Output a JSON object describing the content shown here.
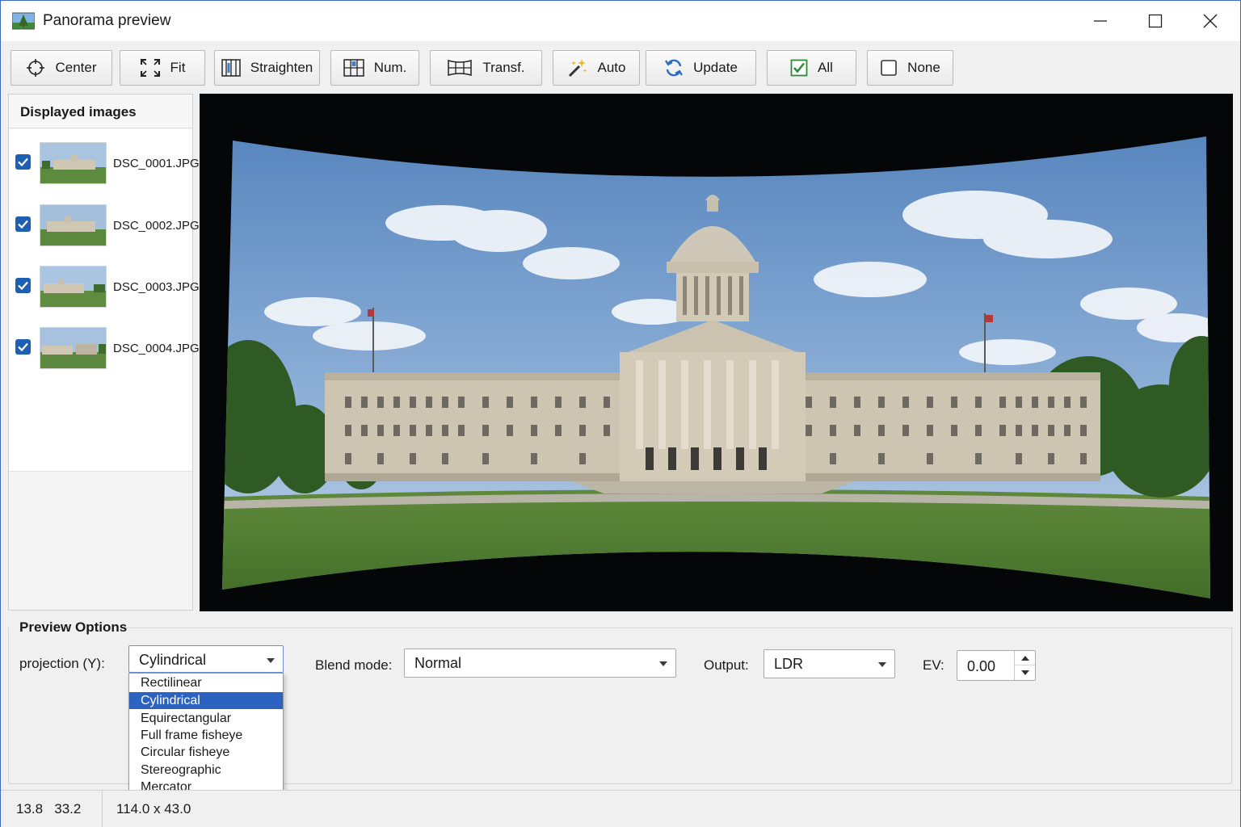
{
  "window": {
    "title": "Panorama preview"
  },
  "toolbar": {
    "center": "Center",
    "fit": "Fit",
    "straighten": "Straighten",
    "num": "Num.",
    "transf": "Transf.",
    "auto": "Auto",
    "update": "Update",
    "all": "All",
    "none": "None"
  },
  "images_panel": {
    "title": "Displayed images",
    "items": [
      {
        "name": "DSC_0001.JPG",
        "checked": true
      },
      {
        "name": "DSC_0002.JPG",
        "checked": true
      },
      {
        "name": "DSC_0003.JPG",
        "checked": true
      },
      {
        "name": "DSC_0004.JPG",
        "checked": true
      }
    ]
  },
  "options": {
    "title": "Preview Options",
    "projection_label": "projection (Y):",
    "projection_value": "Cylindrical",
    "projection_options": [
      "Rectilinear",
      "Cylindrical",
      "Equirectangular",
      "Full frame fisheye",
      "Circular fisheye",
      "Stereographic",
      "Mercator"
    ],
    "blend_label": "Blend mode:",
    "blend_value": "Normal",
    "output_label": "Output:",
    "output_value": "LDR",
    "ev_label": "EV:",
    "ev_value": "0.00"
  },
  "status": {
    "coords": "13.8   33.2",
    "fov": "114.0 x 43.0"
  },
  "colors": {
    "accent": "#2c63c0",
    "checkbox": "#1e5fb4",
    "preview_bg": "#050608"
  }
}
